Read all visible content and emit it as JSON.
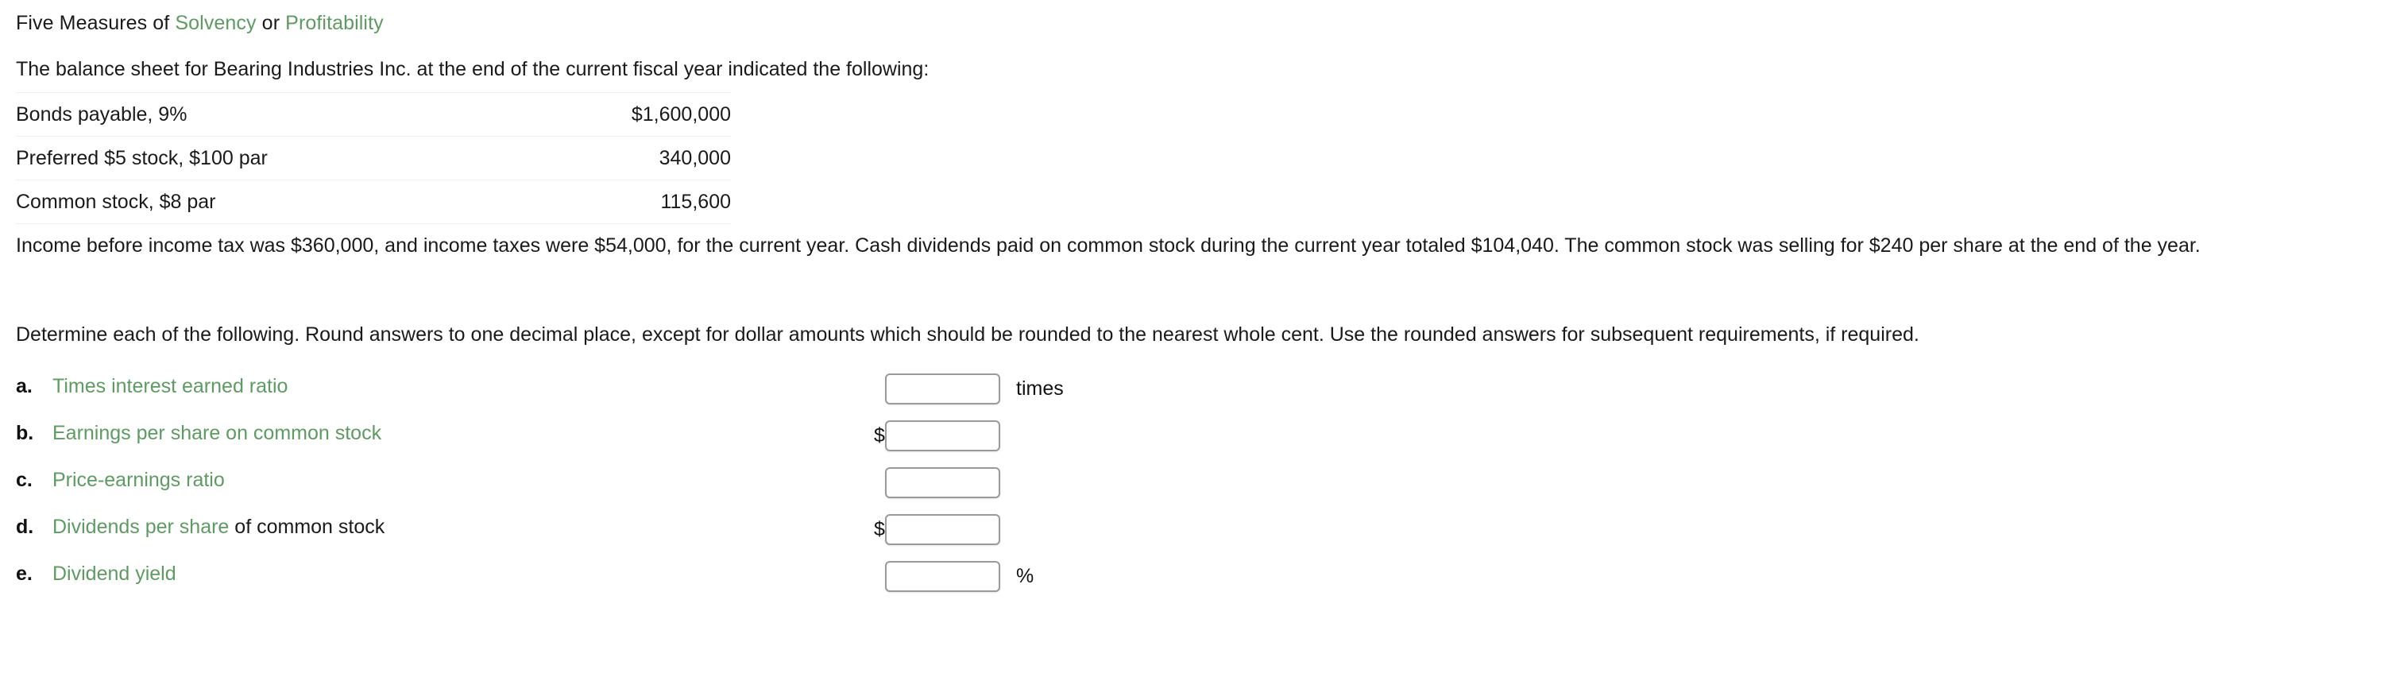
{
  "title": {
    "prefix": "Five Measures of ",
    "term1": "Solvency",
    "middle": " or ",
    "term2": "Profitability"
  },
  "intro": "The balance sheet for Bearing Industries Inc. at the end of the current fiscal year indicated the following:",
  "balance_sheet": {
    "rows": [
      {
        "label": "Bonds payable, 9%",
        "amount": "$1,600,000"
      },
      {
        "label": "Preferred $5 stock, $100 par",
        "amount": "340,000"
      },
      {
        "label": "Common stock, $8 par",
        "amount": "115,600"
      }
    ]
  },
  "paragraphs": {
    "income": "Income before income tax was $360,000, and income taxes were $54,000, for the current year. Cash dividends paid on common stock during the current year totaled $104,040. The common stock was selling for $240 per share at the end of the year.",
    "determine": "Determine each of the following. Round answers to one decimal place, except for dollar amounts which should be rounded to the nearest whole cent. Use the rounded answers for subsequent requirements, if required."
  },
  "answers": [
    {
      "alpha": "a.",
      "label_green": "Times interest earned ratio",
      "label_plain": "",
      "prefix": "",
      "value": "",
      "placeholder": "",
      "suffix": "times"
    },
    {
      "alpha": "b.",
      "label_green": "Earnings per share on common stock",
      "label_plain": "",
      "prefix": "$",
      "value": "",
      "placeholder": "",
      "suffix": ""
    },
    {
      "alpha": "c.",
      "label_green": "Price-earnings ratio",
      "label_plain": "",
      "prefix": "",
      "value": "",
      "placeholder": "",
      "suffix": ""
    },
    {
      "alpha": "d.",
      "label_green": "Dividends per share",
      "label_plain": " of common stock",
      "prefix": "$",
      "value": "",
      "placeholder": "",
      "suffix": ""
    },
    {
      "alpha": "e.",
      "label_green": "Dividend yield",
      "label_plain": "",
      "prefix": "",
      "value": "",
      "placeholder": "",
      "suffix": "%"
    }
  ],
  "colors": {
    "accent_green": "#5d9b62",
    "text": "#1a1a1a",
    "field_border": "#9a9a9a"
  }
}
